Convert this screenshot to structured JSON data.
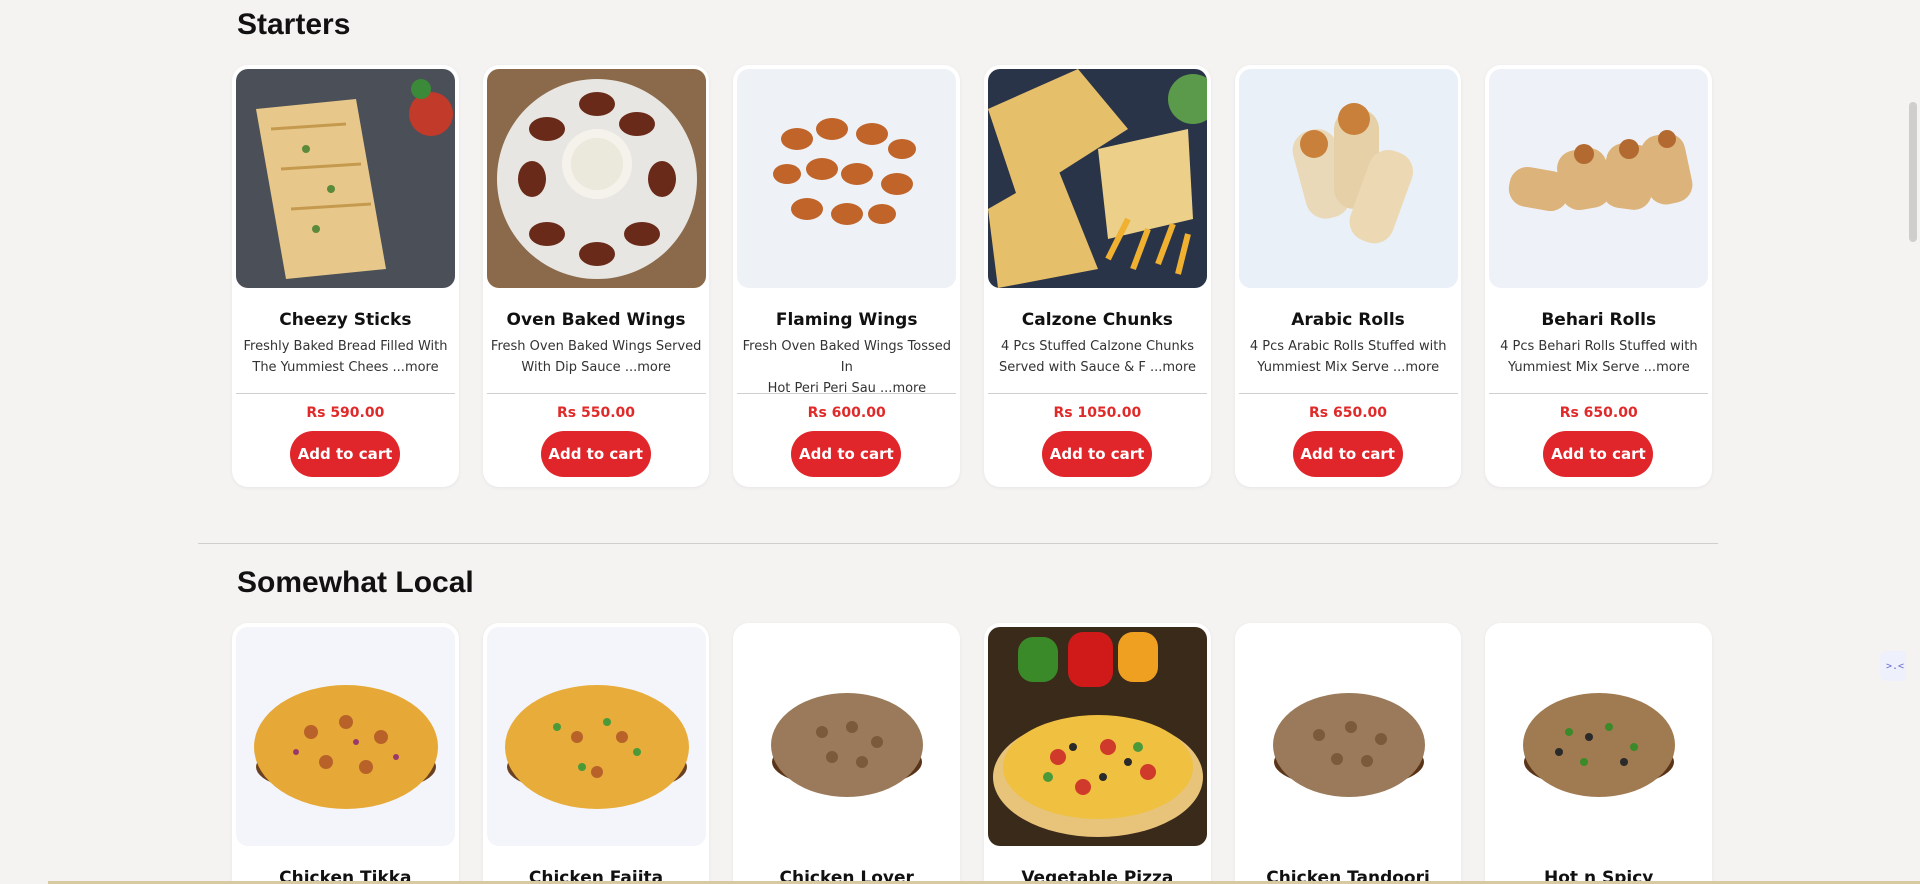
{
  "sections": [
    {
      "title": "Starters",
      "items": [
        {
          "name": "Cheezy Sticks",
          "desc_line1": "Freshly Baked Bread Filled With",
          "desc_line2": "The Yummiest Chees",
          "more": "...more",
          "price": "Rs 590.00",
          "cart_label": "Add to cart",
          "image": "cheezy-sticks-image"
        },
        {
          "name": "Oven Baked Wings",
          "desc_line1": "Fresh Oven Baked Wings Served",
          "desc_line2": "With Dip Sauce",
          "more": "...more",
          "price": "Rs 550.00",
          "cart_label": "Add to cart",
          "image": "oven-baked-wings-image"
        },
        {
          "name": "Flaming Wings",
          "desc_line1": "Fresh Oven Baked Wings Tossed In",
          "desc_line2": "Hot Peri Peri Sau",
          "more": "...more",
          "price": "Rs 600.00",
          "cart_label": "Add to cart",
          "image": "flaming-wings-image"
        },
        {
          "name": "Calzone Chunks",
          "desc_line1": "4 Pcs Stuffed Calzone Chunks",
          "desc_line2": "Served with Sauce & F",
          "more": "...more",
          "price": "Rs 1050.00",
          "cart_label": "Add to cart",
          "image": "calzone-chunks-image"
        },
        {
          "name": "Arabic Rolls",
          "desc_line1": "4 Pcs Arabic Rolls Stuffed with",
          "desc_line2": "Yummiest Mix Serve",
          "more": "...more",
          "price": "Rs 650.00",
          "cart_label": "Add to cart",
          "image": "arabic-rolls-image"
        },
        {
          "name": "Behari Rolls",
          "desc_line1": "4 Pcs Behari Rolls Stuffed with",
          "desc_line2": "Yummiest Mix Serve",
          "more": "...more",
          "price": "Rs 650.00",
          "cart_label": "Add to cart",
          "image": "behari-rolls-image"
        }
      ]
    },
    {
      "title": "Somewhat Local",
      "items": [
        {
          "name": "Chicken Tikka",
          "image": "chicken-tikka-pizza-image"
        },
        {
          "name": "Chicken Fajita",
          "image": "chicken-fajita-pizza-image"
        },
        {
          "name": "Chicken Lover",
          "image": "chicken-lover-pizza-image"
        },
        {
          "name": "Vegetable Pizza",
          "image": "vegetable-pizza-image"
        },
        {
          "name": "Chicken Tandoori",
          "image": "chicken-tandoori-pizza-image"
        },
        {
          "name": "Hot n Spicy",
          "image": "hot-n-spicy-pizza-image"
        }
      ]
    }
  ],
  "widget": {
    "label": ">.<"
  },
  "colors": {
    "accent": "#e0262b",
    "price": "#e02a2a",
    "background": "#f5f3f2"
  }
}
